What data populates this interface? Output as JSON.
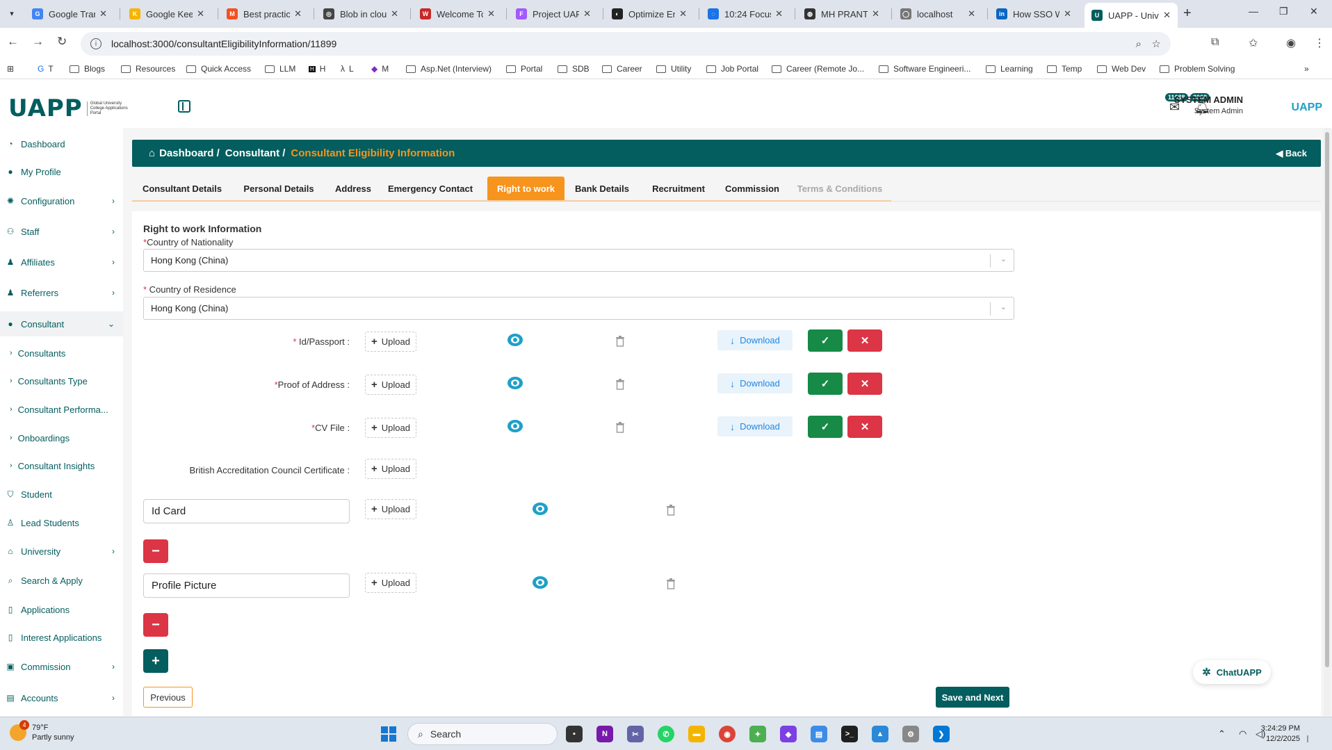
{
  "browser": {
    "tabs": [
      {
        "title": "Google Tran",
        "fav_color": "#4285f4",
        "fav_glyph": "G"
      },
      {
        "title": "Google Keep",
        "fav_color": "#f6b400",
        "fav_glyph": "K"
      },
      {
        "title": "Best practice",
        "fav_color": "#f25022",
        "fav_glyph": "M"
      },
      {
        "title": "Blob in cloud",
        "fav_color": "#444444",
        "fav_glyph": "◎"
      },
      {
        "title": "Welcome To",
        "fav_color": "#c62828",
        "fav_glyph": "W"
      },
      {
        "title": "Project UAPP",
        "fav_color": "#a259ff",
        "fav_glyph": "F"
      },
      {
        "title": "Optimize En",
        "fav_color": "#222222",
        "fav_glyph": "◐"
      },
      {
        "title": "10:24 Focus",
        "fav_color": "#1a73e8",
        "fav_glyph": "◌"
      },
      {
        "title": "MH PRANTA",
        "fav_color": "#333333",
        "fav_glyph": "◍"
      },
      {
        "title": "localhost",
        "fav_color": "#777777",
        "fav_glyph": "◯"
      },
      {
        "title": "How SSO W",
        "fav_color": "#0a66c2",
        "fav_glyph": "in"
      },
      {
        "title": "UAPP - Univ",
        "fav_color": "#045d5e",
        "fav_glyph": "U"
      }
    ],
    "url": "localhost:3000/consultantEligibilityInformation/11899",
    "bookmarks": [
      "T",
      "Blogs",
      "Resources",
      "Quick Access",
      "LLM",
      "H",
      "L",
      "M",
      "Asp.Net (Interview)",
      "Portal",
      "SDB",
      "Career",
      "Utility",
      "Job Portal",
      "Career (Remote Jo...",
      "Software Engineeri...",
      "Learning",
      "Temp",
      "Web Dev",
      "Problem Solving"
    ]
  },
  "header": {
    "logo_text": "UAPP",
    "logo_tagline": "Global University College Applications Portal",
    "badge_messages": "11688",
    "badge_notifications": "3068",
    "user_name": "SYSTEM ADMIN",
    "user_role": "System Admin",
    "right_logo": "UAPP"
  },
  "sidebar": {
    "items": [
      {
        "label": "Dashboard",
        "icon": "dashboard-icon",
        "glyph": "◔"
      },
      {
        "label": "My Profile",
        "icon": "user-icon",
        "glyph": "●"
      },
      {
        "label": "Configuration",
        "icon": "gear-icon",
        "glyph": "✺"
      },
      {
        "label": "Staff",
        "icon": "users-icon",
        "glyph": "⚇"
      },
      {
        "label": "Affiliates",
        "icon": "user-cog-icon",
        "glyph": "♟"
      },
      {
        "label": "Referrers",
        "icon": "user-cog-icon",
        "glyph": "♟"
      },
      {
        "label": "Consultant",
        "icon": "user-icon",
        "glyph": "●"
      }
    ],
    "sub_items": [
      "Consultants",
      "Consultants Type",
      "Consultant Performa...",
      "Onboardings",
      "Consultant Insights"
    ],
    "items_after": [
      {
        "label": "Student",
        "icon": "graduation-cap-icon",
        "glyph": "🎓"
      },
      {
        "label": "Lead Students",
        "icon": "user-graduate-icon",
        "glyph": "♙"
      },
      {
        "label": "University",
        "icon": "university-icon",
        "glyph": "🏛"
      },
      {
        "label": "Search & Apply",
        "icon": "search-icon",
        "glyph": "⌕"
      },
      {
        "label": "Applications",
        "icon": "document-icon",
        "glyph": "▯"
      },
      {
        "label": "Interest Applications",
        "icon": "document-icon",
        "glyph": "▯"
      },
      {
        "label": "Commission",
        "icon": "money-icon",
        "glyph": "▣"
      },
      {
        "label": "Accounts",
        "icon": "accounts-icon",
        "glyph": "▤"
      }
    ]
  },
  "breadcrumb": {
    "home": "Dashboard /",
    "parent": "Consultant /",
    "current": "Consultant Eligibility Information",
    "back": "Back"
  },
  "tabs": [
    "Consultant Details",
    "Personal Details",
    "Address",
    "Emergency Contact",
    "Right to work",
    "Bank Details",
    "Recruitment",
    "Commission",
    "Terms & Conditions"
  ],
  "form": {
    "section_title": "Right to work Information",
    "nationality_label": "Country of Nationality",
    "nationality_value": "Hong Kong (China)",
    "residence_label": " Country of Residence",
    "residence_value": "Hong Kong (China)",
    "documents": [
      {
        "label": "Id/Passport :",
        "required": true
      },
      {
        "label": "Proof of Address :",
        "required": true
      },
      {
        "label": "CV File :",
        "required": true
      },
      {
        "label": "British Accreditation Council Certificate :",
        "required": false
      }
    ],
    "upload_label": "Upload",
    "download_label": "Download",
    "extra_docs": [
      "Id Card",
      "Profile Picture"
    ],
    "previous": "Previous",
    "save_next": "Save and Next"
  },
  "chat": {
    "label": "ChatUAPP"
  },
  "taskbar": {
    "temp": "79°F",
    "weather": "Partly sunny",
    "weather_badge": "4",
    "search": "Search",
    "time": "3:24:29 PM",
    "date": "12/2/2025"
  },
  "colors": {
    "primary": "#045d5e",
    "accent": "#f7941d",
    "danger": "#dc3545",
    "success": "#168a46",
    "info": "#1e88e5"
  }
}
